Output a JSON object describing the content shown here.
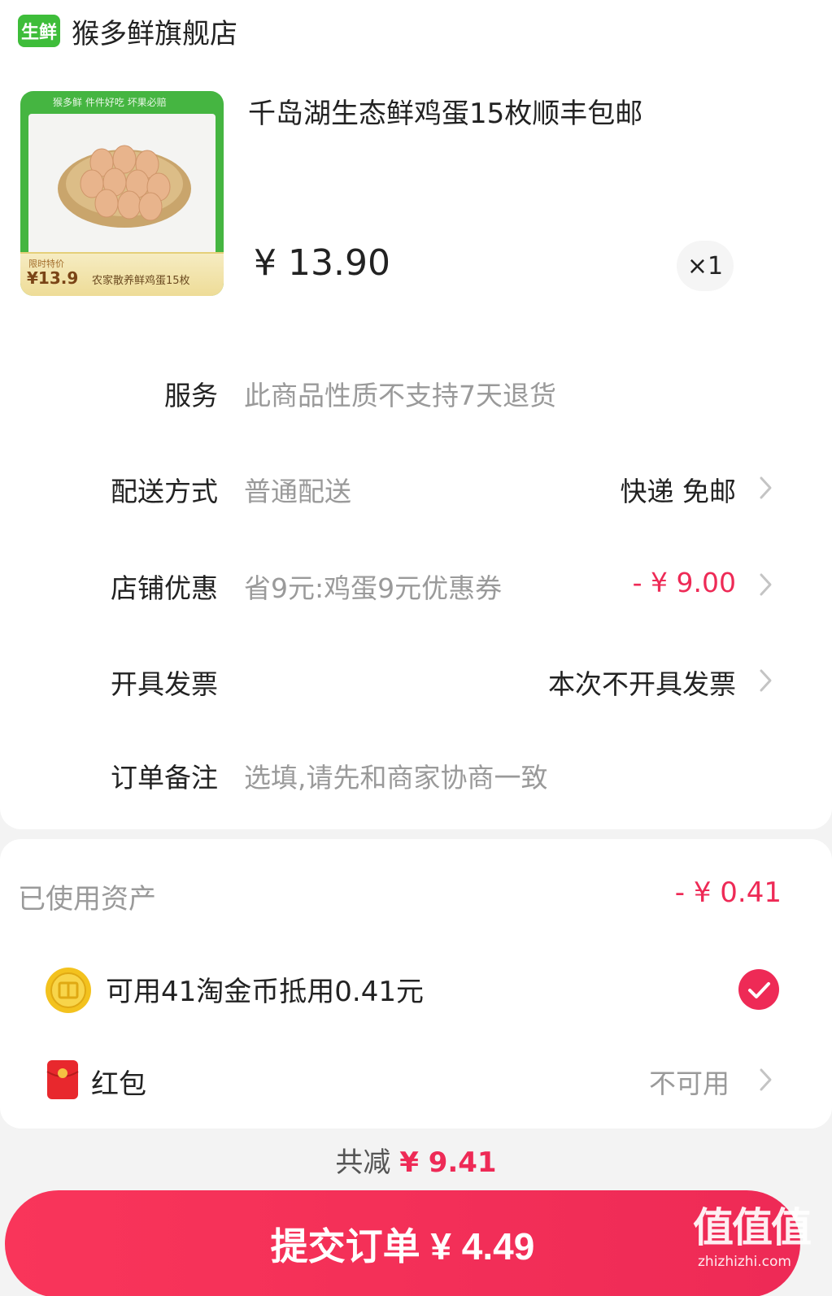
{
  "store": {
    "tag": "生鲜",
    "name": "猴多鲜旗舰店"
  },
  "product": {
    "title": "千岛湖生态鲜鸡蛋15枚顺丰包邮",
    "price": "¥ 13.90",
    "quantity": "×1",
    "image": {
      "banner_text": "猴多鲜  件件好吃 坏果必赔",
      "badge_label": "限时特价",
      "badge_price": "¥13.9",
      "badge_desc": "农家散养鲜鸡蛋15枚"
    }
  },
  "rows": [
    {
      "label": "服务",
      "value": "此商品性质不支持7天退货"
    },
    {
      "label": "配送方式",
      "value": "普通配送",
      "right": "快递 免邮"
    },
    {
      "label": "店铺优惠",
      "value": "省9元:鸡蛋9元优惠券",
      "right": "- ¥ 9.00"
    },
    {
      "label": "开具发票",
      "right": "本次不开具发票"
    },
    {
      "label": "订单备注",
      "value": "选填,请先和商家协商一致"
    }
  ],
  "assets": {
    "title": "已使用资产",
    "amount": "- ¥ 0.41",
    "coin_text": "可用41淘金币抵用0.41元",
    "hongbao_label": "红包",
    "hongbao_status": "不可用"
  },
  "summary": {
    "reduce_label": "共减",
    "reduce_amount": "¥ 9.41",
    "submit_label": "提交订单 ¥ 4.49"
  },
  "watermark": {
    "big": "值值值",
    "small": "zhizhizhi.com"
  },
  "colors": {
    "accent_red": "#ee2a56",
    "store_green": "#3ebd3a",
    "muted_text": "#9a9a9a"
  },
  "icons": [
    "chevron-right-icon",
    "gold-coin-icon",
    "red-envelope-icon",
    "check-icon"
  ]
}
